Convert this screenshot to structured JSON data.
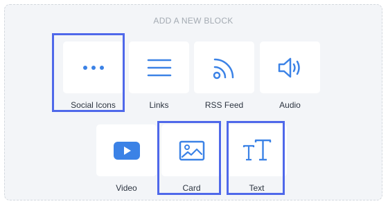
{
  "heading": "ADD A NEW BLOCK",
  "accent_color": "#3b82e6",
  "highlight_color": "#4f68ea",
  "blocks": [
    {
      "label": "Social Icons",
      "icon": "more-dots-icon",
      "highlighted": true
    },
    {
      "label": "Links",
      "icon": "lines-icon",
      "highlighted": false
    },
    {
      "label": "RSS Feed",
      "icon": "rss-icon",
      "highlighted": false
    },
    {
      "label": "Audio",
      "icon": "speaker-icon",
      "highlighted": false
    },
    {
      "label": "Video",
      "icon": "play-icon",
      "highlighted": false
    },
    {
      "label": "Card",
      "icon": "image-icon",
      "highlighted": true
    },
    {
      "label": "Text",
      "icon": "text-size-icon",
      "highlighted": true
    }
  ]
}
